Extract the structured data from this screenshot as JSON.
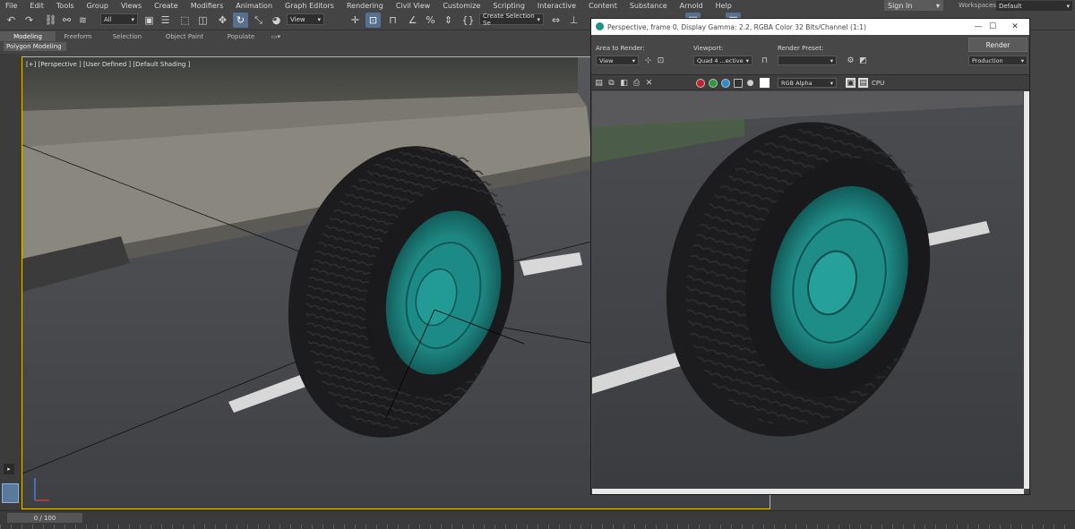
{
  "menu": [
    "File",
    "Edit",
    "Tools",
    "Group",
    "Views",
    "Create",
    "Modifiers",
    "Animation",
    "Graph Editors",
    "Rendering",
    "Civil View",
    "Customize",
    "Scripting",
    "Interactive",
    "Content",
    "Substance",
    "Arnold",
    "Help"
  ],
  "account": {
    "signin_label": "Sign In"
  },
  "workspace": {
    "label": "Workspaces:",
    "value": "Default"
  },
  "toolbar": {
    "filter_value": "All",
    "ref_coord_value": "View",
    "selection_set_placeholder": "Create Selection Se"
  },
  "ribbon": {
    "tabs": [
      "Modeling",
      "Freeform",
      "Selection",
      "Object Paint",
      "Populate"
    ],
    "active_tab": "Modeling",
    "sub_label": "Polygon Modeling"
  },
  "viewport": {
    "label": "[+] [Perspective ] [User Defined ] [Default Shading ]"
  },
  "timeline": {
    "frame_label": "0 / 100"
  },
  "render_window": {
    "title": "Perspective, frame 0, Display Gamma: 2.2, RGBA Color 32 Bits/Channel (1:1)",
    "area_label": "Area to Render:",
    "area_value": "View",
    "viewport_label": "Viewport:",
    "viewport_value": "Quad 4 ...ective",
    "preset_label": "Render Preset:",
    "preset_value": "",
    "render_button": "Render",
    "quality_value": "Production",
    "channel_value": "RGB Alpha",
    "cpu_label": "CPU"
  },
  "colors": {
    "accent": "#5a6f8c",
    "viewport_border": "#e0c000",
    "rim": "#1f8a87",
    "tire": "#1c1c1e"
  }
}
